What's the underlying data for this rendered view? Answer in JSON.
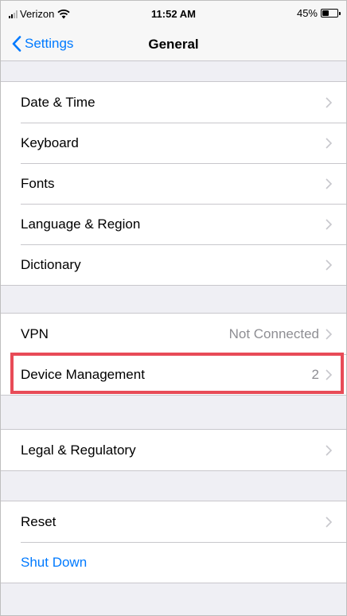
{
  "status_bar": {
    "carrier": "Verizon",
    "time": "11:52 AM",
    "battery_percent": "45%",
    "battery_level": 0.45
  },
  "nav": {
    "back_label": "Settings",
    "title": "General"
  },
  "groups": {
    "input": [
      {
        "label": "Date & Time"
      },
      {
        "label": "Keyboard"
      },
      {
        "label": "Fonts"
      },
      {
        "label": "Language & Region"
      },
      {
        "label": "Dictionary"
      }
    ],
    "network": [
      {
        "label": "VPN",
        "value": "Not Connected"
      },
      {
        "label": "Device Management",
        "value": "2"
      }
    ],
    "legal": [
      {
        "label": "Legal & Regulatory"
      }
    ],
    "reset": [
      {
        "label": "Reset"
      },
      {
        "label": "Shut Down"
      }
    ]
  },
  "colors": {
    "accent": "#007aff",
    "highlight": "#e84b57",
    "background": "#efeff4"
  }
}
